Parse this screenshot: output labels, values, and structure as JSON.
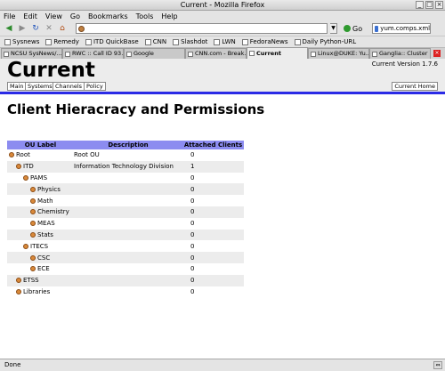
{
  "window": {
    "title": "Current - Mozilla Firefox"
  },
  "menu": [
    "File",
    "Edit",
    "View",
    "Go",
    "Bookmarks",
    "Tools",
    "Help"
  ],
  "toolbar": {
    "url_value": "",
    "go_label": "Go",
    "search_value": "yum.comps.xml"
  },
  "bookmarks": [
    "Sysnews",
    "Remedy",
    "ITD QuickBase",
    "CNN",
    "Slashdot",
    "LWN",
    "FedoraNews",
    "Daily Python-URL"
  ],
  "tabs": [
    {
      "label": "NCSU SysNews/...",
      "active": false
    },
    {
      "label": "RWC :: Call ID 93...",
      "active": false
    },
    {
      "label": "Google",
      "active": false
    },
    {
      "label": "CNN.com - Break...",
      "active": false
    },
    {
      "label": "Current",
      "active": true
    },
    {
      "label": "Linux@DUKE: Yu...",
      "active": false
    },
    {
      "label": "Ganglia:: Cluster ...",
      "active": false
    }
  ],
  "page": {
    "site_title": "Current",
    "version": "Current Version 1.7.6",
    "nav_tabs": [
      "Main",
      "Systems",
      "Channels",
      "Policy"
    ],
    "home_link": "Current Home",
    "heading": "Client Hieracracy and Permissions",
    "table": {
      "headers": [
        "OU Label",
        "Description",
        "Attached Clients"
      ],
      "rows": [
        {
          "label": "Root",
          "depth": 0,
          "description": "Root OU",
          "clients": "0"
        },
        {
          "label": "ITD",
          "depth": 1,
          "description": "Information Technology Division",
          "clients": "1"
        },
        {
          "label": "PAMS",
          "depth": 2,
          "description": "",
          "clients": "0"
        },
        {
          "label": "Physics",
          "depth": 3,
          "description": "",
          "clients": "0"
        },
        {
          "label": "Math",
          "depth": 3,
          "description": "",
          "clients": "0"
        },
        {
          "label": "Chemistry",
          "depth": 3,
          "description": "",
          "clients": "0"
        },
        {
          "label": "MEAS",
          "depth": 3,
          "description": "",
          "clients": "0"
        },
        {
          "label": "Stats",
          "depth": 3,
          "description": "",
          "clients": "0"
        },
        {
          "label": "ITECS",
          "depth": 2,
          "description": "",
          "clients": "0"
        },
        {
          "label": "CSC",
          "depth": 3,
          "description": "",
          "clients": "0"
        },
        {
          "label": "ECE",
          "depth": 3,
          "description": "",
          "clients": "0"
        },
        {
          "label": "ETSS",
          "depth": 1,
          "description": "",
          "clients": "0"
        },
        {
          "label": "Libraries",
          "depth": 1,
          "description": "",
          "clients": "0"
        }
      ]
    }
  },
  "status": {
    "text": "Done"
  },
  "colors": {
    "header_blue": "#8c8cf0",
    "rule_blue": "#2b2be6",
    "row_alt": "#ececec"
  }
}
